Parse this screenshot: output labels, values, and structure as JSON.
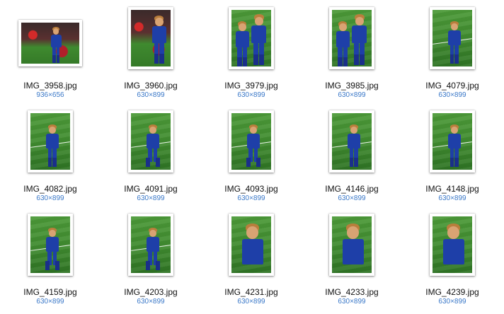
{
  "files": [
    {
      "name": "IMG_3958.jpg",
      "dims": "936×656",
      "orientation": "landscape",
      "scene": "crowd"
    },
    {
      "name": "IMG_3960.jpg",
      "dims": "630×899",
      "orientation": "portrait",
      "scene": "crowd"
    },
    {
      "name": "IMG_3979.jpg",
      "dims": "630×899",
      "orientation": "portrait",
      "scene": "group"
    },
    {
      "name": "IMG_3985.jpg",
      "dims": "630×899",
      "orientation": "portrait",
      "scene": "group"
    },
    {
      "name": "IMG_4079.jpg",
      "dims": "630×899",
      "orientation": "portrait",
      "scene": "standing"
    },
    {
      "name": "IMG_4082.jpg",
      "dims": "630×899",
      "orientation": "portrait",
      "scene": "standing"
    },
    {
      "name": "IMG_4091.jpg",
      "dims": "630×899",
      "orientation": "portrait",
      "scene": "walking"
    },
    {
      "name": "IMG_4093.jpg",
      "dims": "630×899",
      "orientation": "portrait",
      "scene": "walking"
    },
    {
      "name": "IMG_4146.jpg",
      "dims": "630×899",
      "orientation": "portrait",
      "scene": "standing"
    },
    {
      "name": "IMG_4148.jpg",
      "dims": "630×899",
      "orientation": "portrait",
      "scene": "standing"
    },
    {
      "name": "IMG_4159.jpg",
      "dims": "630×899",
      "orientation": "portrait",
      "scene": "walking"
    },
    {
      "name": "IMG_4203.jpg",
      "dims": "630×899",
      "orientation": "portrait",
      "scene": "walking"
    },
    {
      "name": "IMG_4231.jpg",
      "dims": "630×899",
      "orientation": "portrait",
      "scene": "closeup"
    },
    {
      "name": "IMG_4233.jpg",
      "dims": "630×899",
      "orientation": "portrait",
      "scene": "closeup"
    },
    {
      "name": "IMG_4239.jpg",
      "dims": "630×899",
      "orientation": "portrait",
      "scene": "closeup"
    }
  ],
  "colors": {
    "dims_text": "#3a78c8",
    "name_text": "#111111",
    "kit_blue": "#1e3fa8",
    "pitch_green": "#3f8a2f"
  }
}
